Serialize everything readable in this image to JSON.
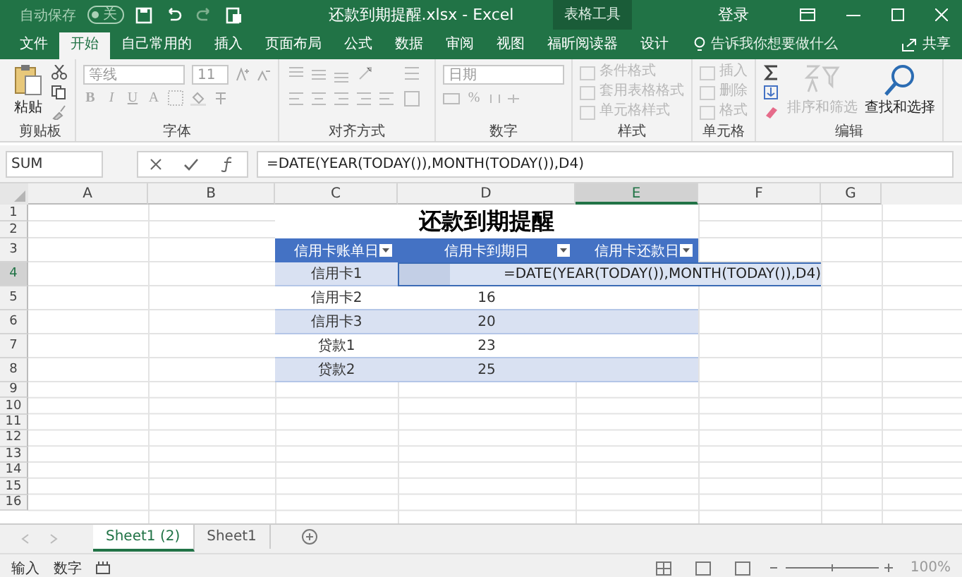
{
  "title_bar": {
    "autosave_label": "自动保存",
    "autosave_on": false,
    "autosave_state": "关",
    "title": "还款到期提醒.xlsx  -  Excel",
    "context_label": "表格工具",
    "signin": "登录"
  },
  "tabs": [
    {
      "label": "文件",
      "selected": false
    },
    {
      "label": "开始",
      "selected": true
    },
    {
      "label": "自己常用的",
      "selected": false
    },
    {
      "label": "插入",
      "selected": false
    },
    {
      "label": "页面布局",
      "selected": false
    },
    {
      "label": "公式",
      "selected": false
    },
    {
      "label": "数据",
      "selected": false
    },
    {
      "label": "审阅",
      "selected": false
    },
    {
      "label": "视图",
      "selected": false
    },
    {
      "label": "福昕阅读器",
      "selected": false
    },
    {
      "label": "设计",
      "selected": false
    }
  ],
  "tell_me": "告诉我你想要做什么",
  "share": "共享",
  "ribbon": [
    {
      "name": "剪贴板",
      "items": [
        {
          "kind": "paste",
          "label": "粘贴",
          "disabled": false
        },
        {
          "kind": "clipboard_tools"
        }
      ]
    },
    {
      "name": "字体",
      "items": [
        {
          "kind": "font_tools",
          "font": "等线",
          "size": "11",
          "letters": [
            "B",
            "I",
            "U",
            "A"
          ]
        }
      ]
    },
    {
      "name": "对齐方式",
      "items": [
        {
          "kind": "align_tools"
        }
      ]
    },
    {
      "name": "数字",
      "items": [
        {
          "kind": "number_tools",
          "format": "日期",
          "letters": [
            "%"
          ]
        }
      ]
    },
    {
      "name": "样式",
      "items": [
        {
          "kind": "list",
          "entries": [
            {
              "label": "条件格式",
              "disabled": true
            },
            {
              "label": "套用表格格式",
              "disabled": true
            },
            {
              "label": "单元格样式",
              "disabled": true
            }
          ]
        }
      ]
    },
    {
      "name": "单元格",
      "items": [
        {
          "kind": "list",
          "entries": [
            {
              "label": "插入",
              "disabled": true
            },
            {
              "label": "删除",
              "disabled": true
            },
            {
              "label": "格式",
              "disabled": true
            }
          ]
        }
      ]
    },
    {
      "name": "编辑",
      "items": [
        {
          "kind": "edit_tools"
        },
        {
          "kind": "sort",
          "label": "排序和筛选",
          "disabled": true
        },
        {
          "kind": "find",
          "label": "查找和选择",
          "disabled": false
        }
      ]
    }
  ],
  "formula_bar": {
    "name_box": "SUM",
    "formula": "=DATE(YEAR(TODAY()),MONTH(TODAY()),D4)"
  },
  "columns": [
    {
      "label": "A",
      "selected": false
    },
    {
      "label": "B",
      "selected": false
    },
    {
      "label": "C",
      "selected": false
    },
    {
      "label": "D",
      "selected": false
    },
    {
      "label": "E",
      "selected": true
    },
    {
      "label": "F",
      "selected": false
    },
    {
      "label": "G",
      "selected": false
    }
  ],
  "rows": [
    {
      "label": "1",
      "selected": false
    },
    {
      "label": "2",
      "selected": false
    },
    {
      "label": "3",
      "selected": false
    },
    {
      "label": "4",
      "selected": true
    },
    {
      "label": "5",
      "selected": false
    },
    {
      "label": "6",
      "selected": false
    },
    {
      "label": "7",
      "selected": false
    },
    {
      "label": "8",
      "selected": false
    },
    {
      "label": "9",
      "selected": false
    },
    {
      "label": "10",
      "selected": false
    },
    {
      "label": "11",
      "selected": false
    },
    {
      "label": "12",
      "selected": false
    },
    {
      "label": "13",
      "selected": false
    },
    {
      "label": "14",
      "selected": false
    },
    {
      "label": "15",
      "selected": false
    },
    {
      "label": "16",
      "selected": false
    }
  ],
  "sheet": {
    "title": "还款到期提醒",
    "table": {
      "columns": [
        "信用卡账单日",
        "信用卡到期日",
        "信用卡还款日"
      ],
      "rows": [
        [
          "信用卡1",
          "",
          ""
        ],
        [
          "信用卡2",
          "16",
          ""
        ],
        [
          "信用卡3",
          "20",
          ""
        ],
        [
          "贷款1",
          "23",
          ""
        ],
        [
          "贷款2",
          "25",
          ""
        ]
      ]
    },
    "editing": {
      "text": "=DATE(YEAR(TODAY()),MONTH(TODAY()),D4)"
    }
  },
  "sheet_tabs": [
    {
      "label": "Sheet1 (2)",
      "selected": true
    },
    {
      "label": "Sheet1",
      "selected": false
    }
  ],
  "status_bar": {
    "items": [
      "输入",
      "数字"
    ],
    "zoom": "100%"
  }
}
